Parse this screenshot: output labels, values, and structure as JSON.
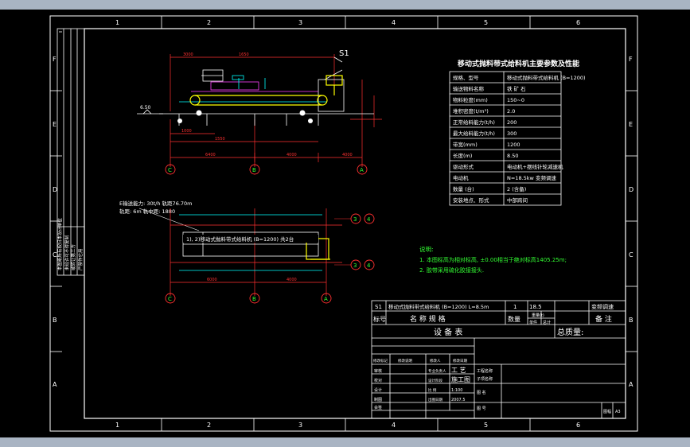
{
  "colors": {
    "background": "#a9b4c3",
    "sheet": "#000000",
    "line": "#ffffff",
    "accent_yellow": "#ffff00",
    "accent_green": "#33ff33",
    "accent_red": "#ff3030",
    "accent_cyan": "#00ffff",
    "accent_magenta": "#ff40ff"
  },
  "border": {
    "top_numbers": [
      "1",
      "2",
      "3",
      "4",
      "5",
      "6"
    ],
    "bottom_numbers": [
      "1",
      "2",
      "3",
      "4",
      "5",
      "6"
    ],
    "left_letters": [
      "F",
      "E",
      "D",
      "C",
      "B",
      "A"
    ],
    "right_letters": [
      "F",
      "E",
      "D",
      "C",
      "B",
      "A"
    ]
  },
  "drawing": {
    "s1_label": "S1",
    "level_label": "6.50",
    "top_dims": [
      "3000",
      "1650",
      "1000",
      "1550",
      "6400",
      "4000",
      "4000"
    ],
    "bottom_dims": [
      "6000",
      "4000"
    ],
    "top_axis": [
      "C",
      "B",
      "A"
    ],
    "bottom_axis": [
      "C",
      "B",
      "A"
    ],
    "right_axis": [
      "3",
      "4",
      "3",
      "4"
    ],
    "note_line1": "E输送能力: 30t/h 轨距76.70m",
    "note_line2": "轨距: 6m 轨中距: 1880",
    "equip_label": "1), 2)移动式抛料带式给料机 (B=1200) 共2台"
  },
  "params": {
    "title": "移动式抛料带式给料机主要参数及性能",
    "rows": [
      {
        "label": "规格、型号",
        "value": "移动式抛料带式给料机 (B=1200)"
      },
      {
        "label": "输送物料名称",
        "value": "铁 矿 石"
      },
      {
        "label": "物料粒度(mm)",
        "value": "150~0"
      },
      {
        "label": "堆积密度(t/m³)",
        "value": "2.0"
      },
      {
        "label": "正常给料能力(t/h)",
        "value": "200"
      },
      {
        "label": "最大给料能力(t/h)",
        "value": "300"
      },
      {
        "label": "带宽(mm)",
        "value": "1200"
      },
      {
        "label": "长度(m)",
        "value": "8.50"
      },
      {
        "label": "驱动形式",
        "value": "电动机+摆线针轮减速机"
      },
      {
        "label": "电动机",
        "value": "N=18.5kw 变频调速"
      },
      {
        "label": "数量 (台)",
        "value": "2 (含备)"
      },
      {
        "label": "安装地点、形式",
        "value": "中部跨间"
      }
    ]
  },
  "notes": {
    "heading": "说明:",
    "items": [
      "1. 本图标高为相对标高, ±0.00相当于绝对标高1405.25m;",
      "2. 胶带采用硫化胶接接头."
    ]
  },
  "title_block": {
    "equip_row": {
      "tag": "S1",
      "name": "移动式抛料带式给料机 (B=1200) L=8.5m",
      "qty": "1",
      "weight": "18.5",
      "remark": "变频调速"
    },
    "header": {
      "no": "标号",
      "name": "名 称 规 格",
      "qty": "数量",
      "unit_weight": "单件",
      "total_weight": "总计",
      "weight_head": "重量(t)",
      "remark": "备 注"
    },
    "schedule_label": "设 备 表",
    "total_weight_label": "总质量:",
    "signature_rows": [
      {
        "role": "审核",
        "sub": "",
        "col": "专业负责人",
        "val": "工 艺"
      },
      {
        "role": "校对",
        "sub": "",
        "col": "设计阶段",
        "val": "施工图"
      },
      {
        "role": "设计",
        "sub": "",
        "col": "比 例",
        "val": "1:100"
      },
      {
        "role": "制图",
        "sub": "",
        "col": "出图日期",
        "val": "2007.5"
      },
      {
        "role": "会签",
        "sub": "",
        "col": "",
        "val": ""
      }
    ],
    "change_headers": [
      "修改标记",
      "修改说明",
      "修改人",
      "修改日期"
    ],
    "mid_labels": [
      "工程名称",
      "子项名称",
      "图 名",
      "图 号"
    ],
    "sheet_label": "图幅",
    "sheet_value": "A3"
  },
  "left_stamp": [
    "本图纸所有权归本设计单位",
    "未经许可不得复制",
    "或转让第三方",
    "严禁作它用"
  ]
}
